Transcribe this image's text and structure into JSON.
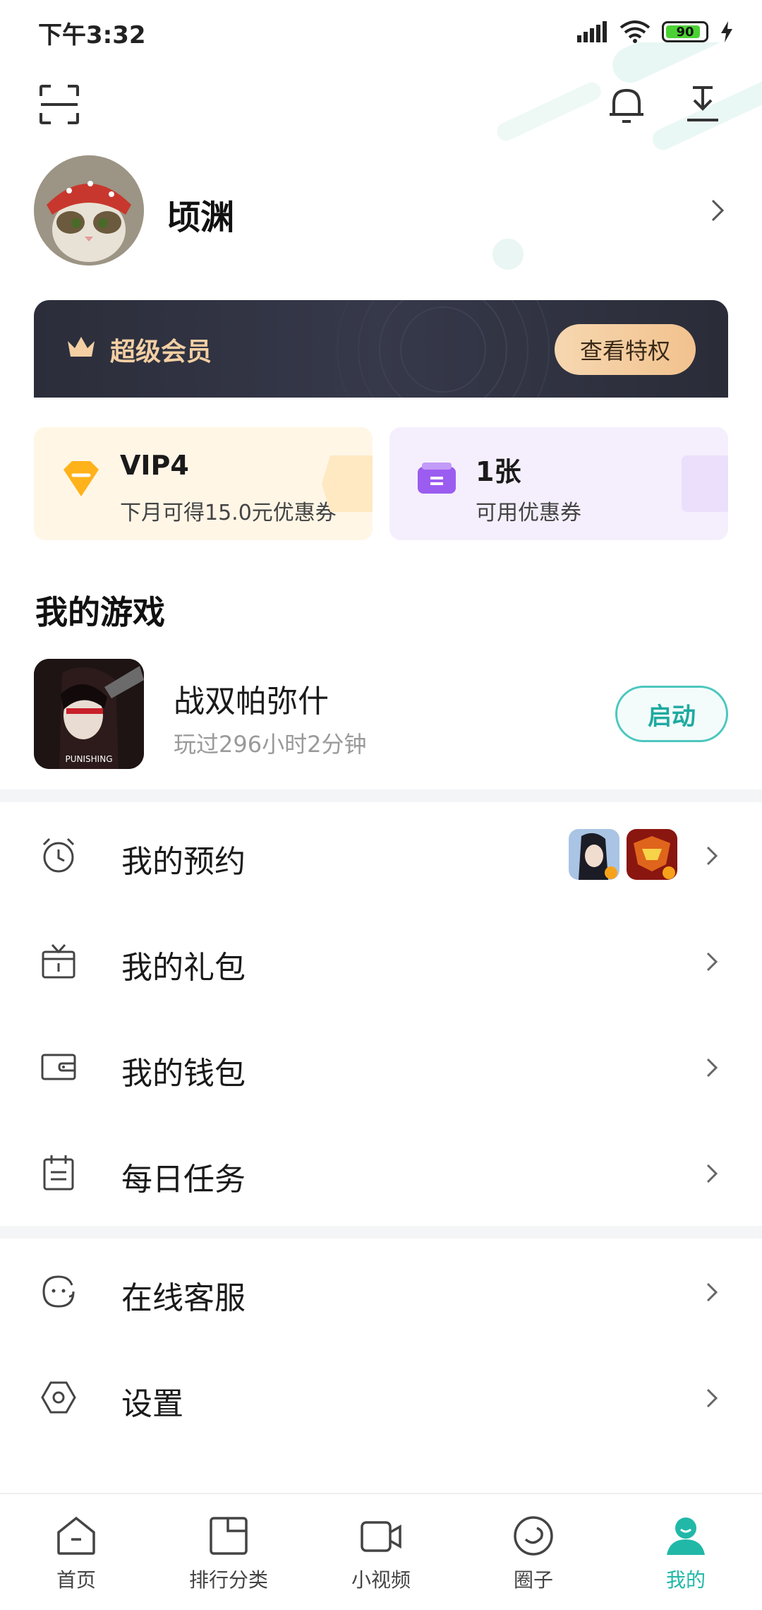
{
  "status_bar": {
    "time": "下午3:32",
    "battery": "90",
    "battery_level": 0.9
  },
  "header": {
    "scan_icon": "scan-icon",
    "bell_icon": "bell-icon",
    "download_icon": "download-icon"
  },
  "profile": {
    "username": "顷渊"
  },
  "vip_banner": {
    "label": "超级会员",
    "button": "查看特权"
  },
  "stats": {
    "vip": {
      "title": "VIP4",
      "subtitle": "下月可得15.0元优惠券"
    },
    "coupon": {
      "title": "1张",
      "subtitle": "可用优惠券"
    }
  },
  "my_games": {
    "title": "我的游戏",
    "game": {
      "name": "战双帕弥什",
      "playtime": "玩过296小时2分钟",
      "icon_text": "PUNISHING",
      "launch_label": "启动"
    }
  },
  "menu_group_1": [
    {
      "label": "我的预约",
      "icon": "alarm-clock-icon"
    },
    {
      "label": "我的礼包",
      "icon": "gift-icon"
    },
    {
      "label": "我的钱包",
      "icon": "wallet-icon"
    },
    {
      "label": "每日任务",
      "icon": "calendar-task-icon"
    }
  ],
  "menu_group_2": [
    {
      "label": "在线客服",
      "icon": "customer-service-icon"
    },
    {
      "label": "设置",
      "icon": "settings-hexagon-icon"
    }
  ],
  "bottom_nav": [
    {
      "label": "首页",
      "icon": "home-icon"
    },
    {
      "label": "排行分类",
      "icon": "ranking-icon"
    },
    {
      "label": "小视频",
      "icon": "video-icon"
    },
    {
      "label": "圈子",
      "icon": "circle-icon"
    },
    {
      "label": "我的",
      "icon": "profile-icon",
      "active": true
    }
  ],
  "colors": {
    "accent": "#22b8a8",
    "vip_gold": "#f3cfa3",
    "launch_border": "#4cc7bf"
  }
}
